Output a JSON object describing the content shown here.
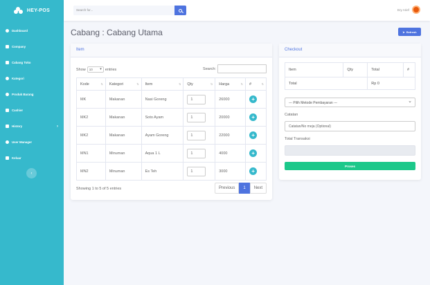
{
  "app": {
    "brand": "HEY-POS"
  },
  "sidebar": {
    "items": [
      {
        "label": "Dashboard",
        "icon": "dashboard-icon"
      },
      {
        "label": "Company",
        "icon": "building-icon"
      },
      {
        "label": "Cabang Toko",
        "icon": "store-icon"
      },
      {
        "label": "Kategori",
        "icon": "gear-icon"
      },
      {
        "label": "Produk Barang",
        "icon": "box-icon"
      },
      {
        "label": "Cashier",
        "icon": "cart-icon"
      },
      {
        "label": "History",
        "icon": "history-icon",
        "has_submenu": true
      },
      {
        "label": "User Manager",
        "icon": "users-icon"
      },
      {
        "label": "Keluar",
        "icon": "logout-icon"
      }
    ],
    "toggle": "‹"
  },
  "topbar": {
    "search_placeholder": "Search for...",
    "user_name": "Ery Arief"
  },
  "page": {
    "title": "Cabang : Cabang Utama",
    "refresh_label": "Refresh"
  },
  "item_card": {
    "title": "Item",
    "show_label": "Show",
    "entries_value": "10",
    "entries_label": "entries",
    "search_label": "Search:",
    "columns": [
      "Kode",
      "Kategori",
      "Item",
      "Qty",
      "Harga",
      "#"
    ],
    "rows": [
      {
        "kode": "MK",
        "kategori": "Makanan",
        "item": "Nasi Goreng",
        "qty": "1",
        "harga": "26000"
      },
      {
        "kode": "MK2",
        "kategori": "Makanan",
        "item": "Soto Ayam",
        "qty": "1",
        "harga": "20000"
      },
      {
        "kode": "MK2",
        "kategori": "Makanan",
        "item": "Ayam Goreng",
        "qty": "1",
        "harga": "22000"
      },
      {
        "kode": "MN1",
        "kategori": "Minuman",
        "item": "Aqua 1 L",
        "qty": "1",
        "harga": "4000"
      },
      {
        "kode": "MN2",
        "kategori": "Minuman",
        "item": "Es Teh",
        "qty": "1",
        "harga": "3000"
      }
    ],
    "info": "Showing 1 to 5 of 5 entries",
    "pager": {
      "prev": "Previous",
      "current": "1",
      "next": "Next"
    }
  },
  "checkout": {
    "title": "Checkout",
    "columns": [
      "Item",
      "Qty",
      "Total",
      "#"
    ],
    "total_label": "Total",
    "total_value": "Rp 0",
    "payment_select": "--- Pilih Metode Pembayaran ---",
    "notes_label": "Catatan",
    "notes_placeholder": "Catatan/No meja (Optional)",
    "total_transaksi_label": "Total Transaksi",
    "total_transaksi_value": "",
    "submit_label": "Proses"
  },
  "colors": {
    "sidebar": "#36b9cc",
    "primary": "#4e73df",
    "success": "#1cc88a",
    "info": "#36b9cc"
  }
}
